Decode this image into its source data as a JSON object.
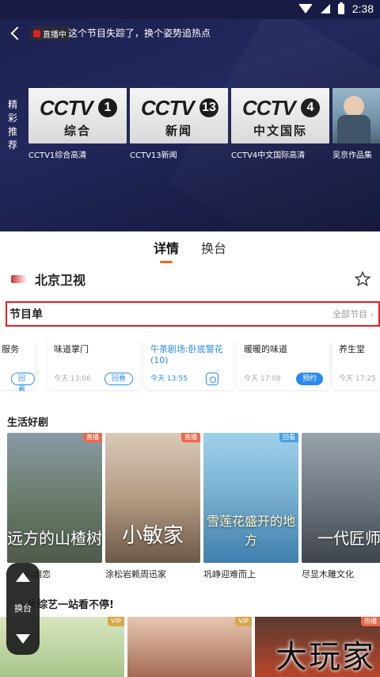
{
  "status_bar": {
    "time": "2:38"
  },
  "hero": {
    "live_badge": "直播中",
    "message": "这个节目失踪了，换个姿势追热点",
    "rec_label": "精彩推荐",
    "channels": [
      {
        "logo": "CCTV",
        "number": "1",
        "sub": "综合",
        "name": "CCTV1综合高清"
      },
      {
        "logo": "CCTV",
        "number": "13",
        "sub": "新闻",
        "name": "CCTV13新闻"
      },
      {
        "logo": "CCTV",
        "number": "4",
        "sub": "中文国际",
        "name": "CCTV4中文国际高清"
      },
      {
        "logo": "",
        "number": "",
        "sub": "",
        "name": "吴京作品集"
      }
    ]
  },
  "tabs": [
    "详情",
    "换台"
  ],
  "station": {
    "name": "北京卫视"
  },
  "schedule": {
    "title": "节目单",
    "all_link": "全部节目",
    "programs": [
      {
        "name": "服务",
        "time": "",
        "action": "回看"
      },
      {
        "name": "味道掌门",
        "time": "今天 13:06",
        "action": "回看"
      },
      {
        "name": "午茶剧场:卧底警花\n(10)",
        "time": "今天 13:55",
        "action": ""
      },
      {
        "name": "暖暖的味道",
        "time": "今天 17:08",
        "action": "预约"
      },
      {
        "name": "养生堂",
        "time": "今天 17:25",
        "action": ""
      }
    ]
  },
  "dramas": {
    "title": "生活好剧",
    "items": [
      {
        "poster_text": "远方的山楂树",
        "title": "川相恋",
        "tag": "直播"
      },
      {
        "poster_text": "小敏家",
        "title": "涂松岩赖周迅家",
        "tag": "直播"
      },
      {
        "poster_text": "雪莲花盛开的地方",
        "title": "巩峥迎难而上",
        "tag": "回看"
      },
      {
        "poster_text": "一代匠师",
        "title": "尽显木雕文化",
        "tag": ""
      }
    ]
  },
  "variety": {
    "title": "片综艺一站看不停!",
    "tags": [
      "VIP",
      "VIP",
      "热播"
    ]
  },
  "float_switch": {
    "label": "换台"
  },
  "watermark": "大玩家",
  "colors": {
    "accent": "#f26522",
    "blue": "#2a8af0",
    "highlight_border": "#e02020",
    "hero_bg": "#1c2150"
  }
}
